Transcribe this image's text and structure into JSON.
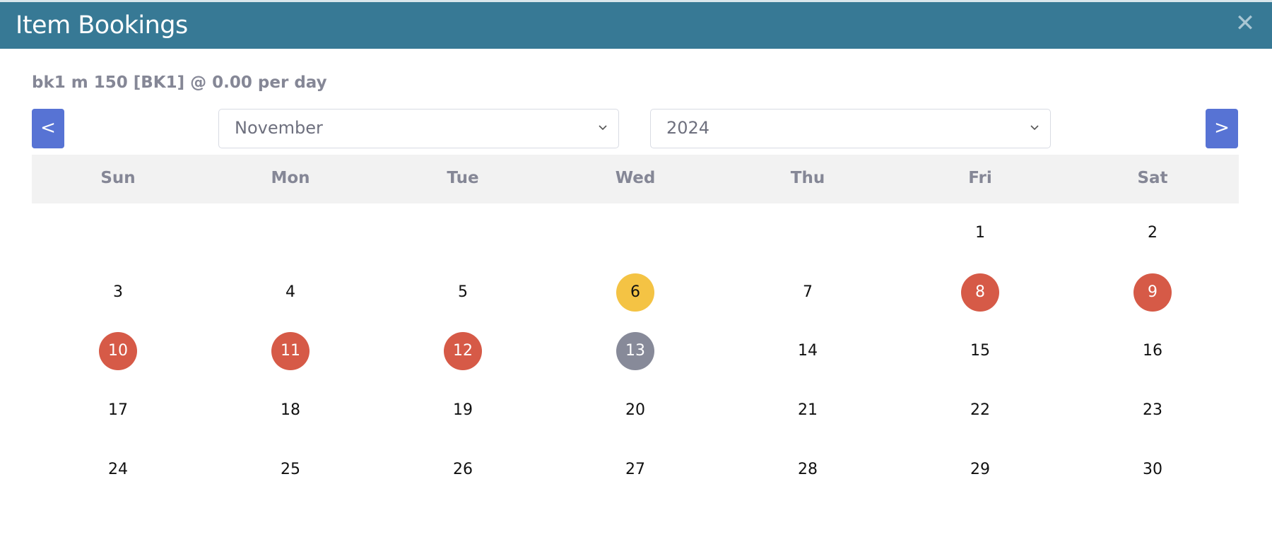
{
  "window": {
    "title": "Item Bookings",
    "close_icon": "close-icon"
  },
  "item": {
    "description": "bk1 m 150 [BK1] @ 0.00 per day"
  },
  "nav": {
    "prev_label": "<",
    "next_label": ">"
  },
  "month_select": {
    "value": "November"
  },
  "year_select": {
    "value": "2024"
  },
  "weekdays": [
    "Sun",
    "Mon",
    "Tue",
    "Wed",
    "Thu",
    "Fri",
    "Sat"
  ],
  "calendar": {
    "first_weekday_index": 5,
    "days_in_month": 30,
    "status_colors": {
      "pending": "#f4c344",
      "booked": "#d65a47",
      "today": "#878a99"
    },
    "status_text_colors": {
      "pending": "#111111",
      "booked": "#ffffff",
      "today": "#ffffff"
    },
    "marked_days": {
      "6": "pending",
      "8": "booked",
      "9": "booked",
      "10": "booked",
      "11": "booked",
      "12": "booked",
      "13": "today"
    }
  },
  "colors": {
    "header_bg": "#377995",
    "button_bg": "#5773d4"
  }
}
